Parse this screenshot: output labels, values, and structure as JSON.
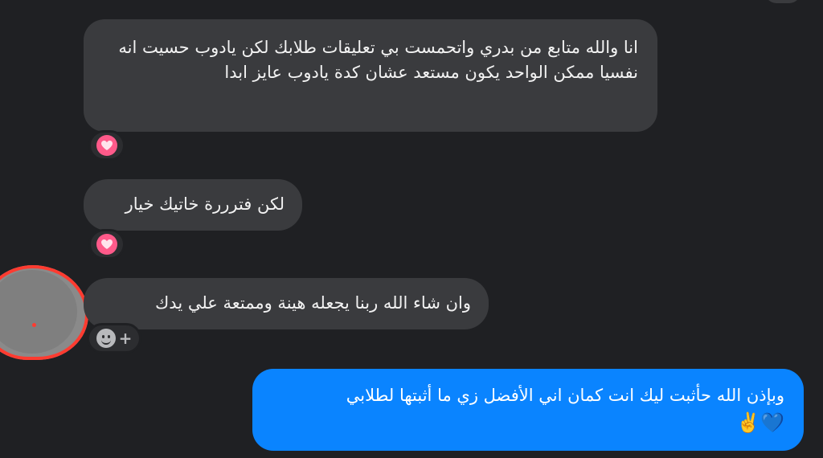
{
  "messages": [
    {
      "direction": "incoming",
      "text": "انا والله متابع من بدري واتحمست بي تعليقات طلابك لكن يادوب حسيت انه نفسيا ممكن الواحد يكون مستعد عشان كدة يادوب عايز ابدا",
      "reaction": "heart"
    },
    {
      "direction": "incoming",
      "text": "لكن فترررة خاتيك خيار",
      "reaction": "heart"
    },
    {
      "direction": "incoming",
      "text": "وان شاء الله ربنا يجعله هينة وممتعة علي يدك",
      "reaction": "add-reaction"
    },
    {
      "direction": "outgoing",
      "text": "وبإذن الله حأثبت ليك انت كمان اني الأفضل زي ما أثبتها لطلابي",
      "emoji": "💙✌️"
    }
  ],
  "colors": {
    "background": "#1f2023",
    "incoming_bubble": "#3a3b3e",
    "outgoing_bubble": "#0a84ff",
    "heart": "#ff5a8a",
    "avatar_ring": "#ff3b30"
  },
  "icons": {
    "reaction_1": "heart-icon",
    "reaction_2": "heart-icon",
    "add_reaction": "smiley-plus-icon"
  }
}
